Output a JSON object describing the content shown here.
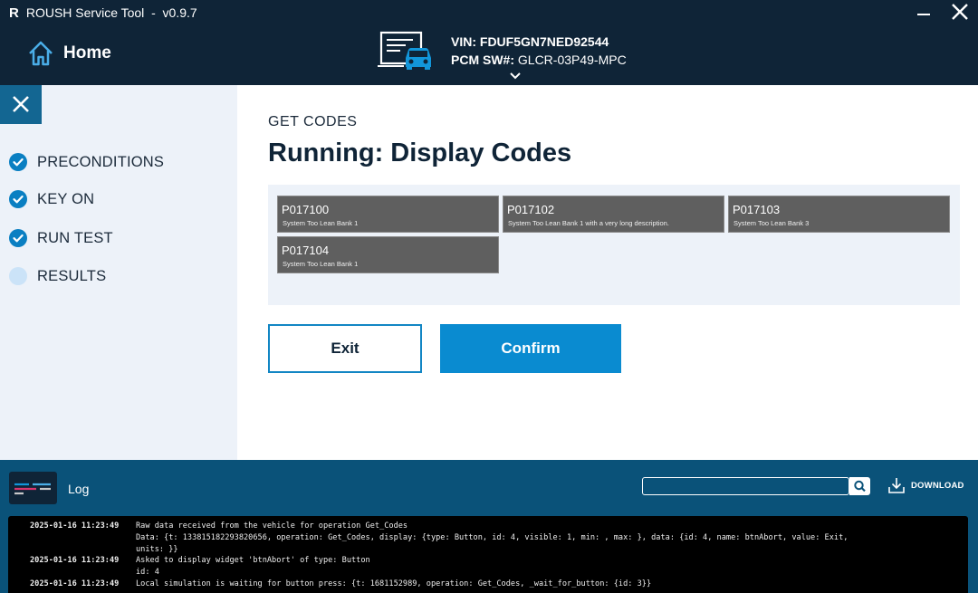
{
  "window": {
    "logo": "R",
    "title": "ROUSH Service Tool  -  v0.9.7"
  },
  "header": {
    "home_label": "Home",
    "vin_label": "VIN: FDUF5GN7NED92544",
    "pcm_label": "PCM SW#:",
    "pcm_value": "GLCR-03P49-MPC"
  },
  "sidebar": {
    "steps": [
      {
        "label": "PRECONDITIONS",
        "status": "done"
      },
      {
        "label": "KEY ON",
        "status": "done"
      },
      {
        "label": "RUN TEST",
        "status": "done"
      },
      {
        "label": "RESULTS",
        "status": "pending"
      }
    ]
  },
  "main": {
    "section_label": "GET CODES",
    "title": "Running: Display Codes",
    "codes": [
      {
        "id": "P017100",
        "desc": "System Too Lean Bank 1"
      },
      {
        "id": "P017102",
        "desc": "System Too Lean Bank 1 with a very long description."
      },
      {
        "id": "P017103",
        "desc": "System Too Lean Bank 3"
      },
      {
        "id": "P017104",
        "desc": "System Too Lean Bank 1"
      }
    ],
    "exit_label": "Exit",
    "confirm_label": "Confirm"
  },
  "log": {
    "title": "Log",
    "search_value": "",
    "download_label": "DOWNLOAD",
    "entries": [
      {
        "timestamp": "2025-01-16 11:23:49",
        "lines": [
          "Raw data received from the vehicle for operation Get_Codes",
          "Data: {t: 133815182293820656, operation: Get_Codes, display: {type: Button, id: 4, visible: 1, min: , max: }, data: {id: 4, name: btnAbort, value: Exit,",
          "units: }}"
        ]
      },
      {
        "timestamp": "2025-01-16 11:23:49",
        "lines": [
          "Asked to display widget 'btnAbort' of type: Button",
          "id: 4"
        ]
      },
      {
        "timestamp": "2025-01-16 11:23:49",
        "lines": [
          "Local simulation is waiting for button press: {t: 1681152989, operation: Get_Codes, _wait_for_button: {id: 3}}"
        ]
      }
    ]
  },
  "colors": {
    "header_bg": "#0f2437",
    "sidebar_bg": "#edf2f9",
    "accent": "#0a8bd0",
    "step_done": "#0a7fc2",
    "step_pending": "#cbe3f8",
    "code_card_bg": "#5f5f5f",
    "log_bg": "#0a5279"
  }
}
